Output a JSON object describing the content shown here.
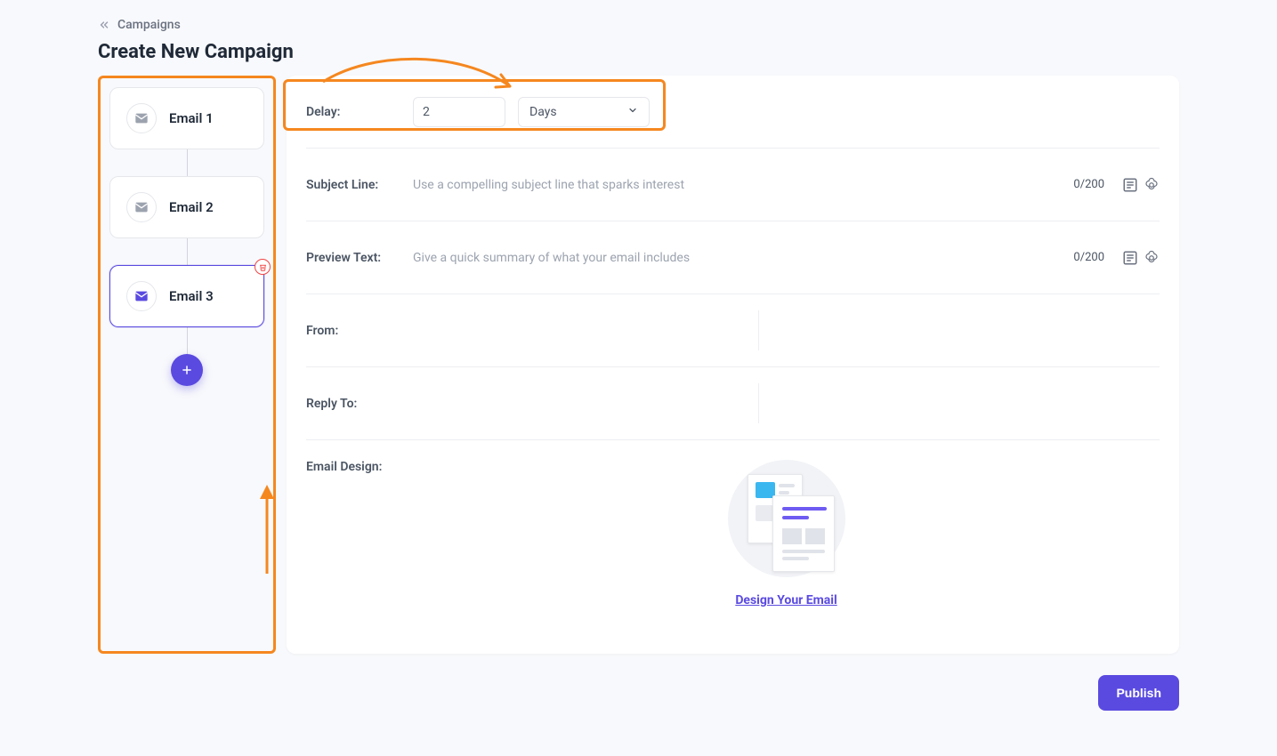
{
  "breadcrumb": {
    "label": "Campaigns"
  },
  "page": {
    "title": "Create New Campaign"
  },
  "sidebar": {
    "items": [
      {
        "label": "Email 1",
        "selected": false
      },
      {
        "label": "Email 2",
        "selected": false
      },
      {
        "label": "Email 3",
        "selected": true
      }
    ]
  },
  "form": {
    "delay": {
      "label": "Delay:",
      "value": "2",
      "unit": "Days"
    },
    "subject": {
      "label": "Subject Line:",
      "placeholder": "Use a compelling subject line that sparks interest",
      "counter": "0/200"
    },
    "preview": {
      "label": "Preview Text:",
      "placeholder": "Give a quick summary of what your email includes",
      "counter": "0/200"
    },
    "from": {
      "label": "From:"
    },
    "reply_to": {
      "label": "Reply To:"
    },
    "design": {
      "label": "Email Design:",
      "link": "Design Your Email"
    }
  },
  "actions": {
    "publish": "Publish"
  },
  "colors": {
    "accent": "#5a4ae0",
    "highlight": "#f5871f"
  }
}
